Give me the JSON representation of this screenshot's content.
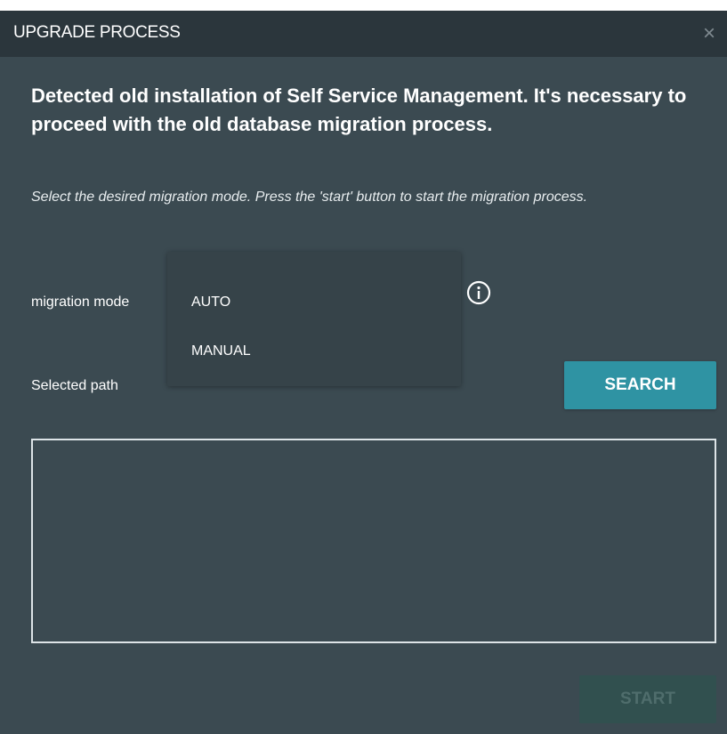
{
  "dialog": {
    "title": "UPGRADE PROCESS",
    "close_glyph": "×",
    "headline": "Detected old installation of Self Service Management. It's necessary to proceed with the old database migration process.",
    "instructions": "Select the desired migration mode. Press the 'start' button to start the migration process."
  },
  "form": {
    "migration_mode_label": "migration mode",
    "mode_options": [
      "AUTO",
      "MANUAL"
    ],
    "selected_path_label": "Selected path",
    "path_value": ""
  },
  "buttons": {
    "search": "SEARCH",
    "start": "START"
  },
  "icons": {
    "close": "close-icon",
    "info": "info-icon"
  },
  "colors": {
    "dialog_bg": "#3b4a51",
    "titlebar_bg": "#2b363c",
    "accent": "#2f93a3",
    "disabled_button": "#31504f"
  }
}
